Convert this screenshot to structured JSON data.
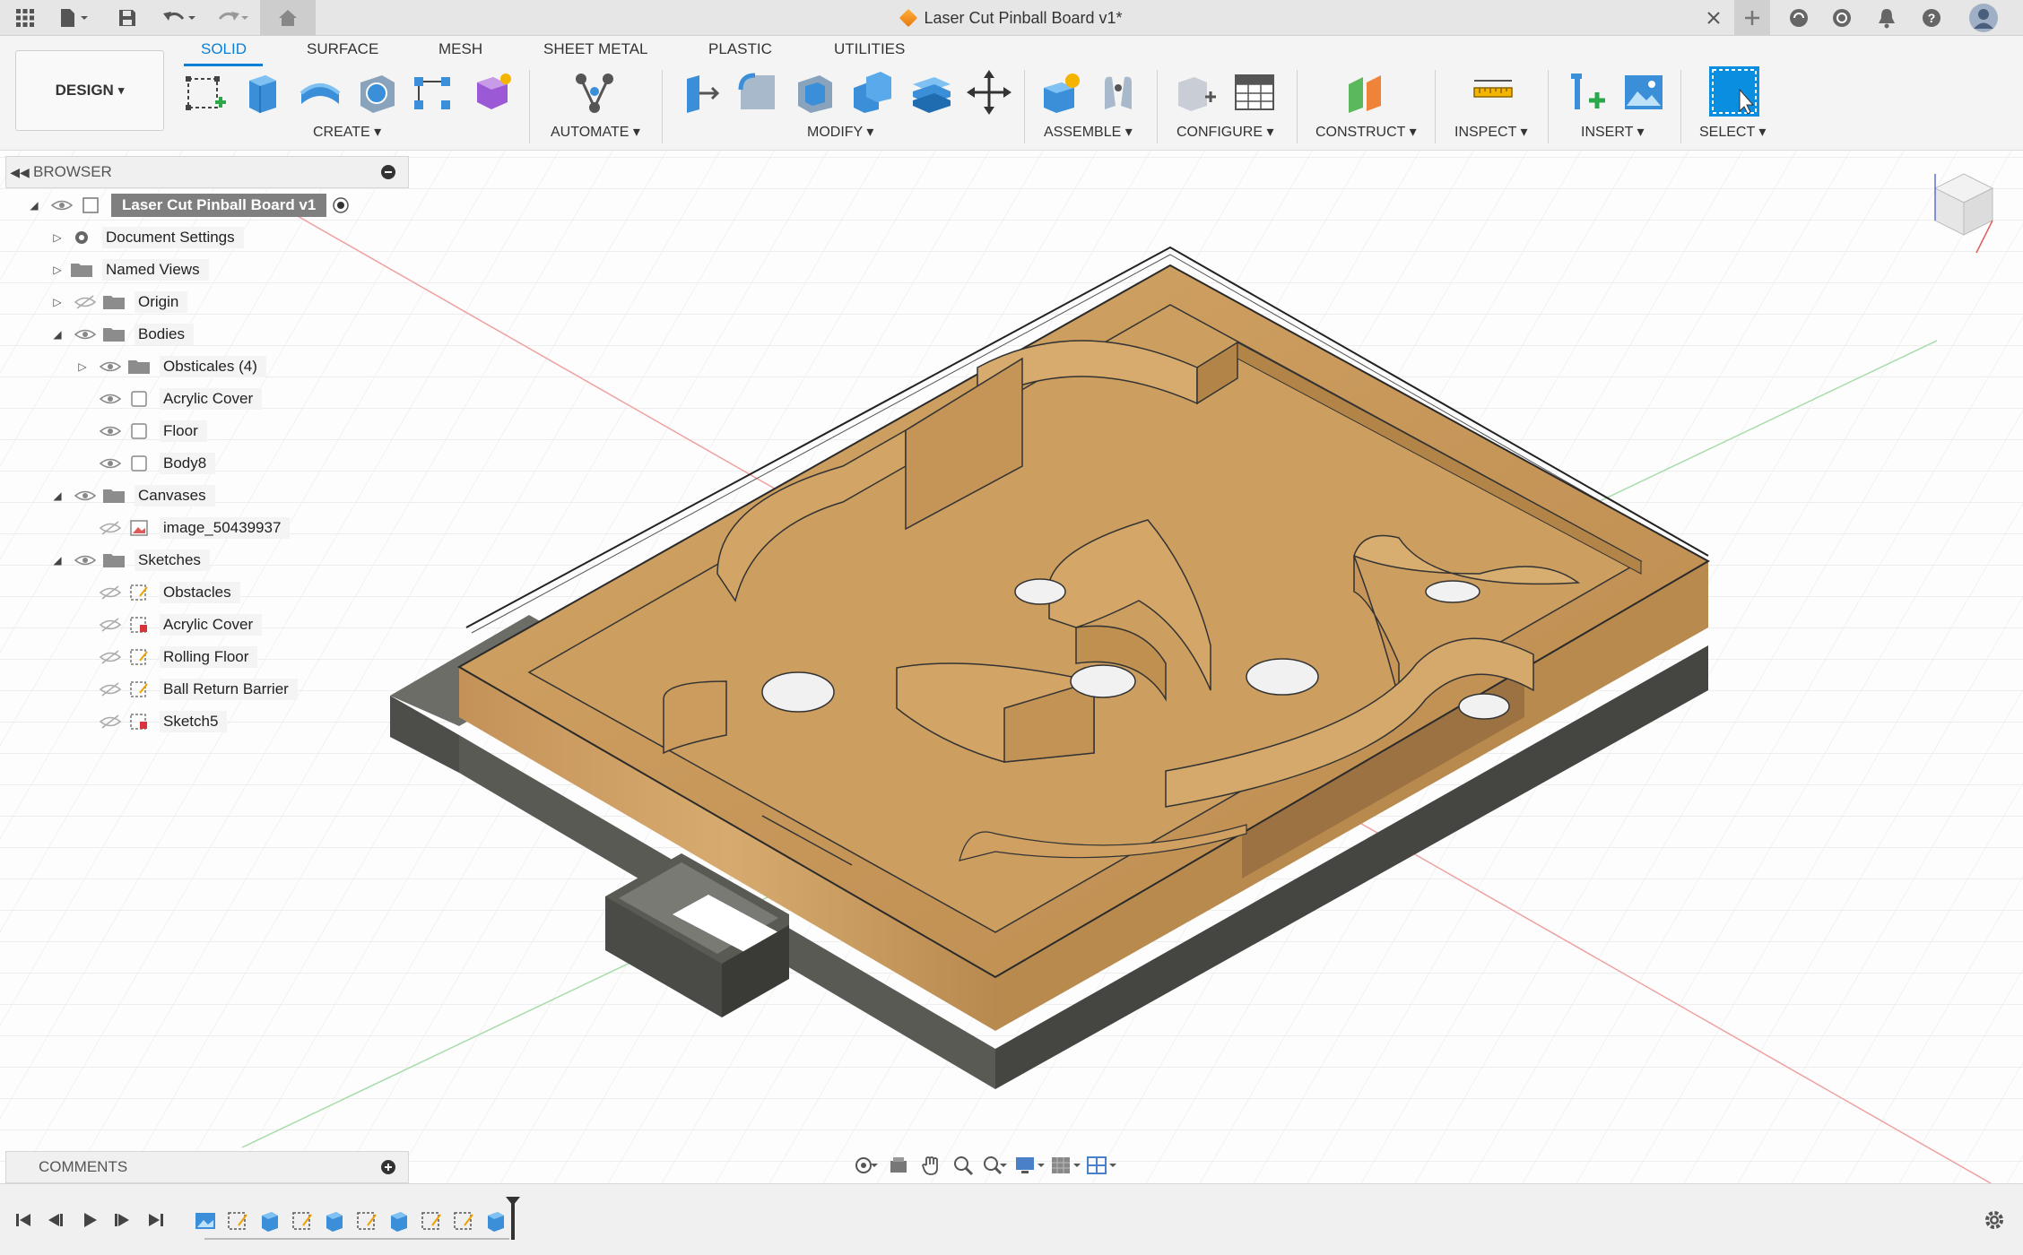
{
  "window": {
    "title": "Laser Cut Pinball Board v1*"
  },
  "ribbon": {
    "workspace": "DESIGN",
    "tabs": [
      {
        "label": "SOLID",
        "active": true
      },
      {
        "label": "SURFACE",
        "active": false
      },
      {
        "label": "MESH",
        "active": false
      },
      {
        "label": "SHEET METAL",
        "active": false
      },
      {
        "label": "PLASTIC",
        "active": false
      },
      {
        "label": "UTILITIES",
        "active": false
      }
    ],
    "groups": {
      "create": "CREATE",
      "automate": "AUTOMATE",
      "modify": "MODIFY",
      "assemble": "ASSEMBLE",
      "configure": "CONFIGURE",
      "construct": "CONSTRUCT",
      "inspect": "INSPECT",
      "insert": "INSERT",
      "select": "SELECT"
    },
    "dropdown_glyph": "▾"
  },
  "browser": {
    "title": "BROWSER",
    "items": [
      {
        "label": "Laser Cut Pinball Board v1",
        "icon": "component-icon"
      },
      {
        "label": "Document Settings",
        "icon": "gear-icon"
      },
      {
        "label": "Named Views",
        "icon": "folder-icon"
      },
      {
        "label": "Origin",
        "icon": "folder-icon"
      },
      {
        "label": "Bodies",
        "icon": "folder-icon"
      },
      {
        "label": "Obsticales (4)",
        "icon": "folder-icon"
      },
      {
        "label": "Acrylic Cover",
        "icon": "body-icon"
      },
      {
        "label": "Floor",
        "icon": "body-icon"
      },
      {
        "label": "Body8",
        "icon": "body-icon"
      },
      {
        "label": "Canvases",
        "icon": "folder-icon"
      },
      {
        "label": "image_50439937",
        "icon": "canvas-icon"
      },
      {
        "label": "Sketches",
        "icon": "folder-icon"
      },
      {
        "label": "Obstacles",
        "icon": "sketch-icon"
      },
      {
        "label": "Acrylic Cover",
        "icon": "sketch-icon"
      },
      {
        "label": "Rolling Floor",
        "icon": "sketch-icon"
      },
      {
        "label": "Ball Return Barrier",
        "icon": "sketch-icon"
      },
      {
        "label": "Sketch5",
        "icon": "sketch-icon"
      }
    ]
  },
  "comments": {
    "title": "COMMENTS"
  },
  "colors": {
    "accent": "#0a7fd8",
    "wood": "#c99a5b",
    "wood_dark": "#a87a40",
    "frame": "#5a5a55",
    "grid": "#e3e3e3"
  }
}
